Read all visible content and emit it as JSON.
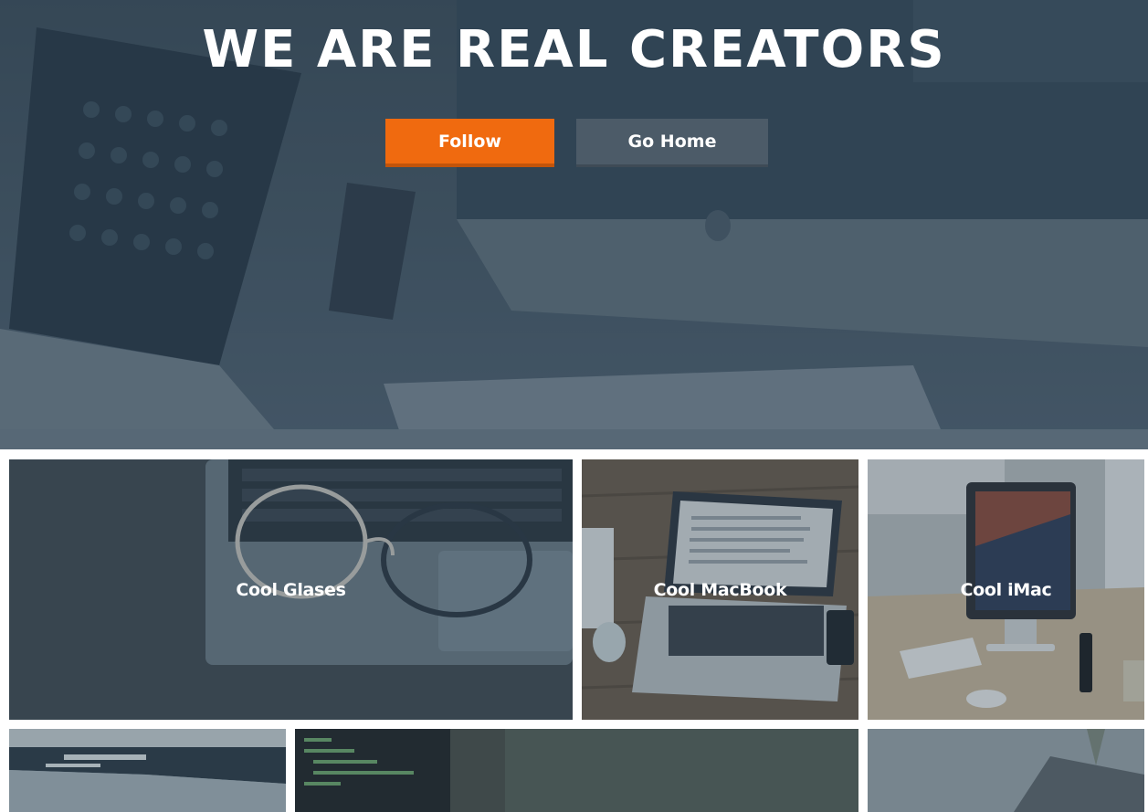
{
  "hero": {
    "title": "WE ARE REAL CREATORS",
    "follow_label": "Follow",
    "home_label": "Go Home",
    "follow_color": "#f06a0f",
    "home_color": "#4c5b68"
  },
  "gallery": {
    "tiles": [
      {
        "label": "Cool Glases",
        "icon": "glasses-photo"
      },
      {
        "label": "Cool MacBook",
        "icon": "macbook-photo"
      },
      {
        "label": "Cool iMac",
        "icon": "imac-photo"
      }
    ]
  }
}
